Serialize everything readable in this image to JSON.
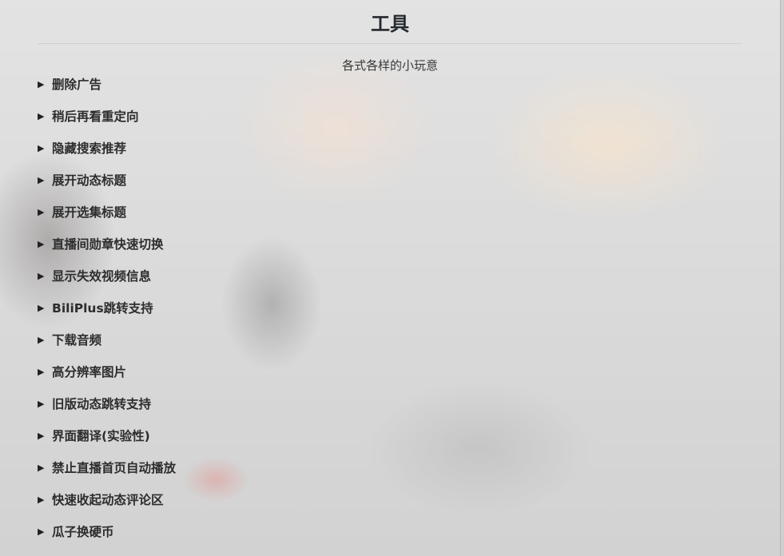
{
  "header": {
    "title": "工具",
    "subtitle": "各式各样的小玩意"
  },
  "icons": {
    "expand": "triangle-right-icon",
    "glyph": "▶"
  },
  "tools": [
    {
      "label": "删除广告"
    },
    {
      "label": "稍后再看重定向"
    },
    {
      "label": "隐藏搜索推荐"
    },
    {
      "label": "展开动态标题"
    },
    {
      "label": "展开选集标题"
    },
    {
      "label": "直播间勋章快速切换"
    },
    {
      "label": "显示失效视频信息"
    },
    {
      "label": "BiliPlus跳转支持"
    },
    {
      "label": "下载音频"
    },
    {
      "label": "高分辨率图片"
    },
    {
      "label": "旧版动态跳转支持"
    },
    {
      "label": "界面翻译(实验性)"
    },
    {
      "label": "禁止直播首页自动播放"
    },
    {
      "label": "快速收起动态评论区"
    },
    {
      "label": "瓜子换硬币"
    }
  ]
}
